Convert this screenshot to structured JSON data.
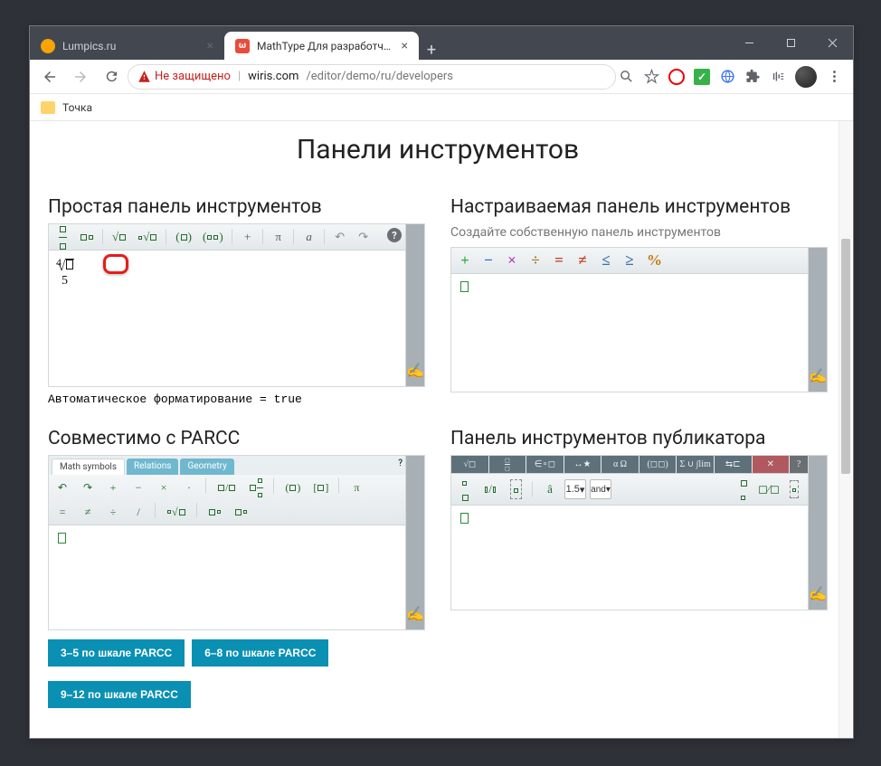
{
  "browser": {
    "tabs": [
      {
        "label": "Lumpics.ru",
        "active": false,
        "favicon": "orange"
      },
      {
        "label": "MathType Для разработчиков (…",
        "active": true,
        "favicon": "red",
        "favglyph": "ω"
      }
    ],
    "notsecure": "Не защищено",
    "url_host": "wiris.com",
    "url_path": "/editor/demo/ru/developers",
    "bookmark": "Точка"
  },
  "page": {
    "title": "Панели инструментов",
    "simple": {
      "heading": "Простая панель инструментов",
      "auto_format": "Автоматическое форматирование = true",
      "expr_top": "4",
      "expr_bottom": "5"
    },
    "custom": {
      "heading": "Настраиваемая панель инструментов",
      "sub": "Создайте собственную панель инструментов"
    },
    "parcc": {
      "heading": "Совместимо с PARCC",
      "tabs": [
        "Math symbols",
        "Relations",
        "Geometry"
      ],
      "buttons": [
        "3–5 по шкале PARCC",
        "6–8 по шкале PARCC",
        "9–12 по шкале PARCC"
      ]
    },
    "publisher": {
      "heading": "Панель инструментов публикатора",
      "spin": "1.5",
      "spin2": "and"
    }
  }
}
